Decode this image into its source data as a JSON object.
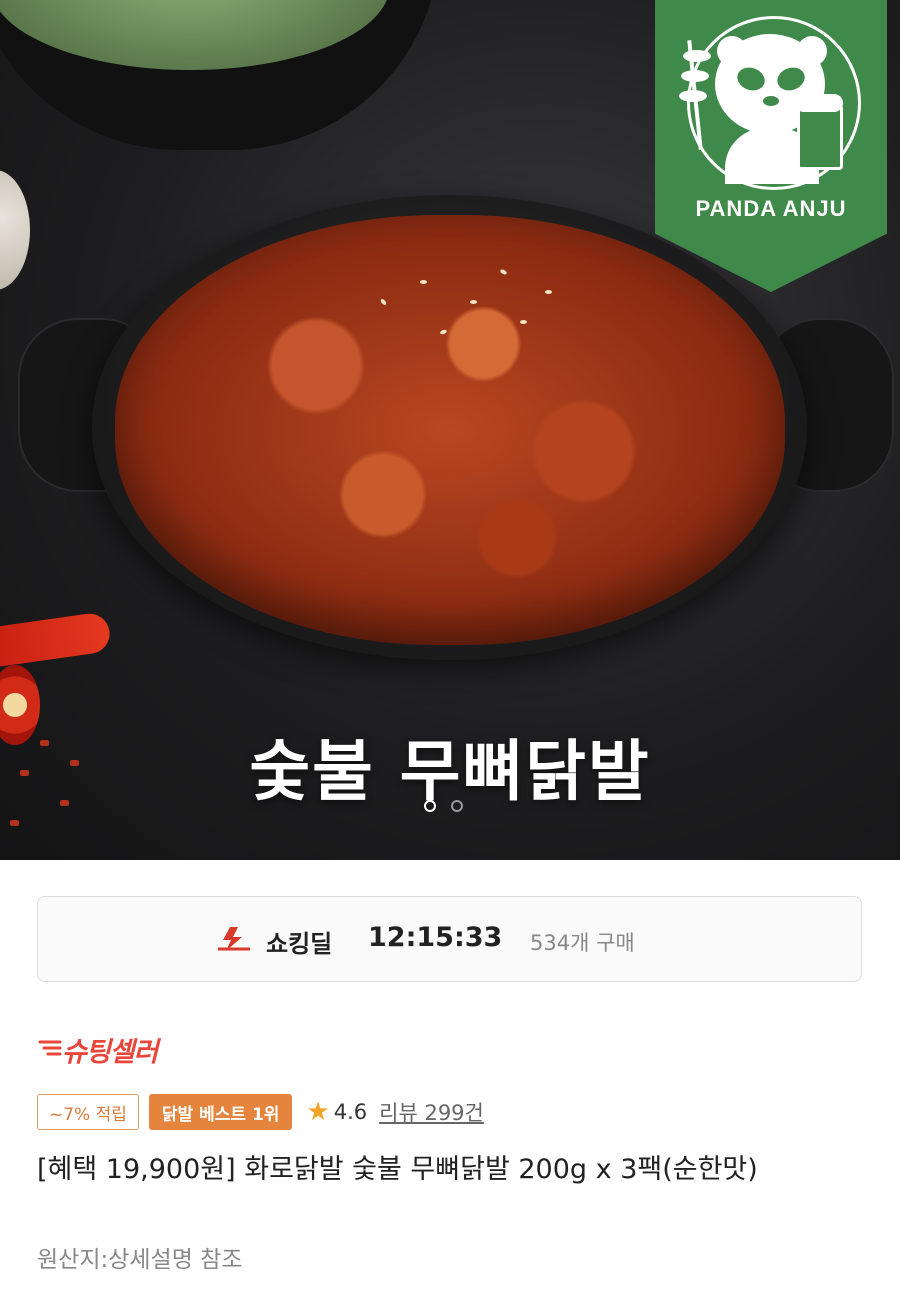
{
  "hero": {
    "title": "숯불 무뼈닭발",
    "brand_logo_text": "PANDA ANJU",
    "carousel": {
      "total": 2,
      "active": 1
    }
  },
  "deal": {
    "label": "쇼킹딜",
    "timer": "12:15:33",
    "purchase_count": "534개 구매",
    "icon": "shocking-deal-icon",
    "accent_color": "#d93a2b"
  },
  "seller_badge": {
    "text": "슈팅셀러",
    "color": "#e8463b"
  },
  "tags": {
    "points": "~7% 적립",
    "best": "닭발 베스트 1위"
  },
  "rating": {
    "score": "4.6",
    "review_label": "리뷰 299건"
  },
  "product": {
    "title": "[혜택 19,900원] 화로닭발 숯불 무뼈닭발 200g x 3팩(순한맛)",
    "origin": "원산지:상세설명 참조"
  },
  "colors": {
    "logo_green": "#3f8a4a",
    "tag_orange": "#e5843c",
    "star": "#f0a52a"
  }
}
